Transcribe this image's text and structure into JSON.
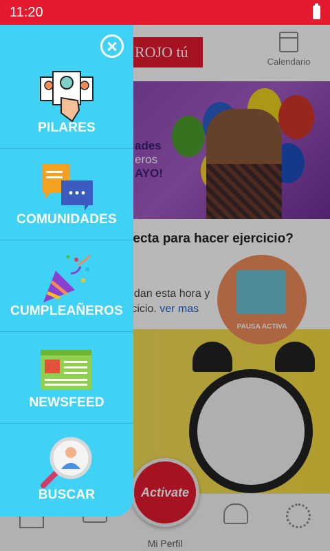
{
  "status_bar": {
    "time": "11:20"
  },
  "header": {
    "logo_text": "ROJO tú",
    "calendar_label": "Calendario"
  },
  "feed": {
    "banner_text_line1": "ades",
    "banner_text_line2": "eros",
    "banner_text_line3": "AYO!",
    "post_title": "recta para hacer ejercicio?",
    "post_body_line1": "ndan esta hora y",
    "post_body_line2": "rcicio.",
    "post_more": "ver mas",
    "pausa_label": "PAUSA ACTIVA"
  },
  "bottom_nav": {
    "profile_label": "Mi Perfil",
    "profile_logo": "Activate"
  },
  "drawer": {
    "items": [
      {
        "label": "PILARES",
        "icon": "pillars-icon"
      },
      {
        "label": "COMUNIDADES",
        "icon": "chat-bubbles-icon"
      },
      {
        "label": "CUMPLEAÑEROS",
        "icon": "party-popper-icon"
      },
      {
        "label": "NEWSFEED",
        "icon": "newspaper-icon"
      },
      {
        "label": "BUSCAR",
        "icon": "search-user-icon"
      }
    ]
  }
}
